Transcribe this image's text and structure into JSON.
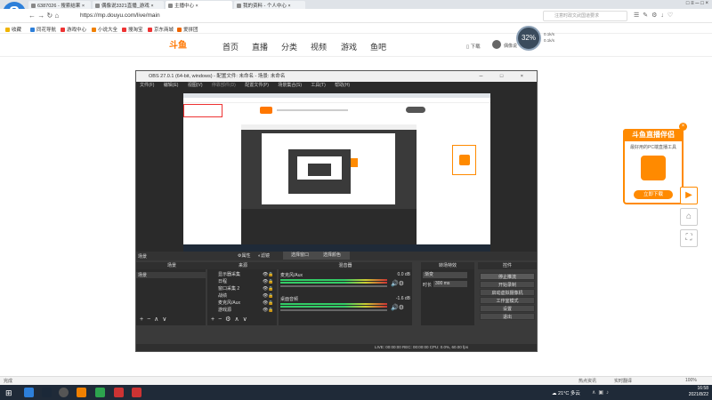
{
  "browser": {
    "tabs": [
      {
        "label": "6387026 - 搜索结果 ×"
      },
      {
        "label": "偶像说3321直播_游戏 ×"
      },
      {
        "label": "主播中心 ×"
      },
      {
        "label": "我的资料 - 个人中心 ×"
      }
    ],
    "url": "https://mp.douyu.com/live/main",
    "search_placeholder": "注意时政文武国道要求",
    "window_controls": "□ ≡ ─ □ ×"
  },
  "bookmarks": [
    {
      "label": "收藏",
      "color": "#f0b400"
    },
    {
      "label": "同花导航",
      "color": "#2d7fd9"
    },
    {
      "label": "游戏中心",
      "color": "#e33"
    },
    {
      "label": "小说大全",
      "color": "#f08000"
    },
    {
      "label": "搜淘宝",
      "color": "#e33"
    },
    {
      "label": "京东商城",
      "color": "#e33"
    },
    {
      "label": "爱拼团",
      "color": "#e60"
    }
  ],
  "douyu": {
    "logo": "斗鱼",
    "nav": [
      "首页",
      "直播",
      "分类",
      "视频",
      "游戏",
      "鱼吧"
    ],
    "download": "下载",
    "user": "偶像说"
  },
  "speed": {
    "value": "32%",
    "up": "0.1k/s",
    "down": "0.1k/s"
  },
  "obs": {
    "title": "OBS 27.0.1 (64-bit, windows) - 配置文件: 未命名 - 场景: 未命名",
    "menu": [
      "文件(F)",
      "编辑(E)",
      "视图(V)",
      "停靠部件(D)",
      "配置文件(P)",
      "场景集合(S)",
      "工具(T)",
      "帮助(H)"
    ],
    "toolbar": {
      "properties": "属性",
      "filters": "滤镜",
      "select_window": "选择窗口",
      "select_color": "选择颜色"
    },
    "panels": {
      "scenes": "场景",
      "sources": "来源",
      "mixer": "混音器",
      "transitions": "转场特效",
      "controls": "控件"
    },
    "scene_item": "场景",
    "sources": [
      "显示器采集",
      "日程",
      "窗口采集 2",
      "战绩",
      "麦克风/Aux",
      "游戏源"
    ],
    "mixer": [
      {
        "name": "麦克风/Aux",
        "db": "0.0 dB"
      },
      {
        "name": "桌面音频",
        "db": "-1.6 dB"
      }
    ],
    "transitions": {
      "type": "渐变",
      "duration_label": "时长",
      "duration": "300 ms"
    },
    "controls": [
      "停止推流",
      "开始录制",
      "启动虚拟摄像机",
      "工作室模式",
      "设置",
      "退出"
    ],
    "status": "LIVE: 00:00:00   REC: 00:00:00   CPU: 0.0%, 60.00 fps"
  },
  "ad": {
    "title": "斗鱼直播伴侣",
    "desc": "最好用的PC端直播工具",
    "button": "立即下载"
  },
  "statusbar": {
    "left": "完成",
    "right": [
      "热点资讯",
      "实时翻译",
      "100%"
    ]
  },
  "taskbar": {
    "weather": "21°C 多云",
    "time": "16:58",
    "date": "2021/8/22"
  }
}
